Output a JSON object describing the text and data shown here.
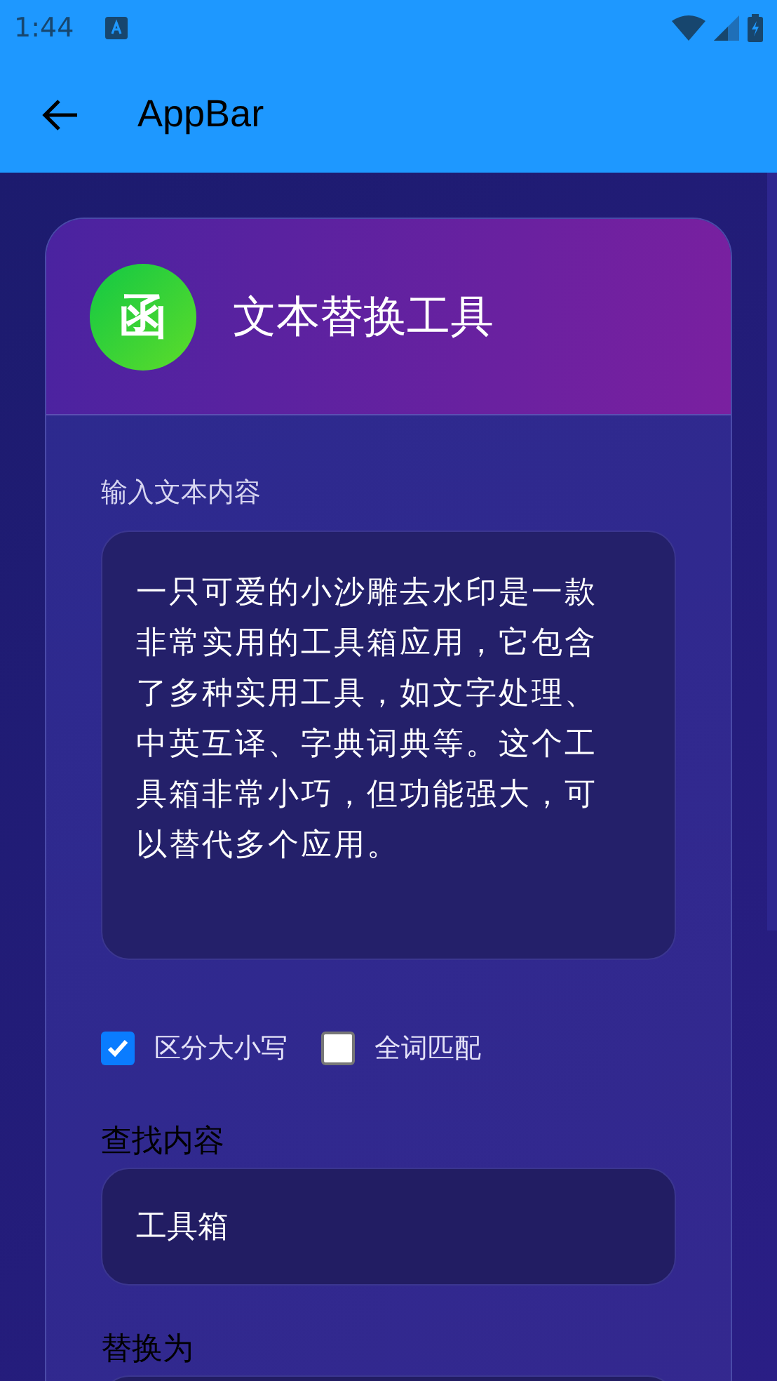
{
  "status_bar": {
    "time": "1:44"
  },
  "app_bar": {
    "title": "AppBar"
  },
  "card": {
    "title": "文本替换工具",
    "icon_glyph": "函",
    "input": {
      "label": "输入文本内容",
      "value": "一只可爱的小沙雕去水印是一款非常实用的工具箱应用，它包含了多种实用工具，如文字处理、中英互译、字典词典等。这个工具箱非常小巧，但功能强大，可以替代多个应用。"
    },
    "options": [
      {
        "label": "区分大小写",
        "checked": true
      },
      {
        "label": "全词匹配",
        "checked": false
      }
    ],
    "find": {
      "label": "查找内容",
      "value": "工具箱"
    },
    "replace": {
      "label": "替换为"
    }
  }
}
